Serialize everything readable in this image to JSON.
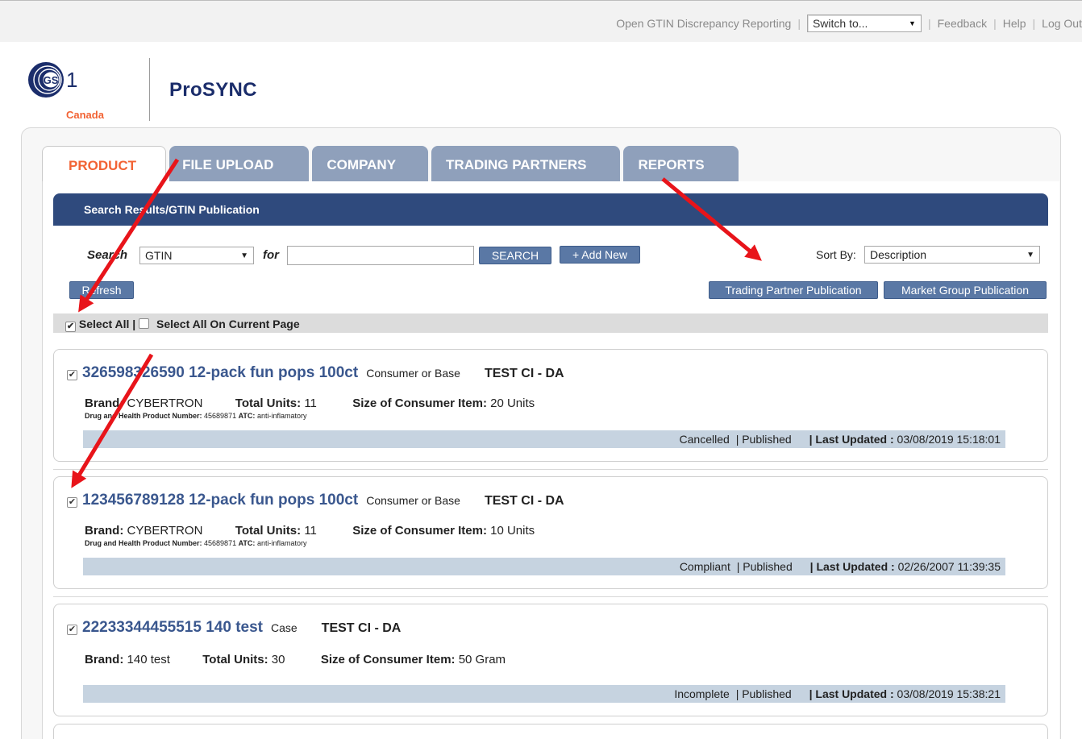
{
  "topbar": {
    "discrepancy_link": "Open GTIN Discrepancy Reporting",
    "switch_value": "Switch to...",
    "feedback": "Feedback",
    "help": "Help",
    "logout": "Log Out"
  },
  "logo": {
    "gs": "GS",
    "one": "1",
    "country": "Canada"
  },
  "app_title": "ProSYNC",
  "tabs": {
    "product": "PRODUCT",
    "file_upload": "FILE UPLOAD",
    "company": "COMPANY",
    "trading_partners": "TRADING PARTNERS",
    "reports": "REPORTS"
  },
  "results_header": "Search Results/GTIN Publication",
  "search": {
    "label": "Search",
    "field_value": "GTIN",
    "for_label": "for",
    "query": "",
    "search_button": "SEARCH",
    "add_new_button": "+ Add New",
    "sort_label": "Sort By:",
    "sort_value": "Description"
  },
  "actions": {
    "refresh": "Refresh",
    "trading_partner_publication": "Trading Partner Publication",
    "market_group_publication": "Market Group Publication"
  },
  "selectbar": {
    "select_all": "Select All |",
    "select_all_page": "Select All On Current Page"
  },
  "products": [
    {
      "gtin_desc": "326598326590 12-pack fun pops 100ct",
      "type": "Consumer or Base",
      "trading_company": "TEST CI - DA",
      "brand_label": "Brand:",
      "brand": "CYBERTRON",
      "units_label": "Total Units:",
      "units": "11",
      "size_label": "Size of Consumer Item:",
      "size": "20 Units",
      "dhpn_label": "Drug and Health Product Number:",
      "dhpn": "45689871",
      "atc_label": "ATC:",
      "atc": "anti-inflamatory",
      "status": "Cancelled",
      "pub": "| Published",
      "updated_label": "| Last Updated :",
      "updated": "03/08/2019 15:18:01"
    },
    {
      "gtin_desc": "123456789128 12-pack fun pops 100ct",
      "type": "Consumer or Base",
      "trading_company": "TEST CI - DA",
      "brand_label": "Brand:",
      "brand": "CYBERTRON",
      "units_label": "Total Units:",
      "units": "11",
      "size_label": "Size of Consumer Item:",
      "size": "10 Units",
      "dhpn_label": "Drug and Health Product Number:",
      "dhpn": "45689871",
      "atc_label": "ATC:",
      "atc": "anti-inflamatory",
      "status": "Compliant",
      "pub": "| Published",
      "updated_label": "| Last Updated :",
      "updated": "02/26/2007 11:39:35"
    },
    {
      "gtin_desc": "22233344455515 140 test",
      "type": "Case",
      "trading_company": "TEST CI - DA",
      "brand_label": "Brand:",
      "brand": "140 test",
      "units_label": "Total Units:",
      "units": "30",
      "size_label": "Size of Consumer Item:",
      "size": "50 Gram",
      "status": "Incomplete",
      "pub": "| Published",
      "updated_label": "| Last Updated :",
      "updated": "03/08/2019 15:38:21"
    }
  ],
  "colors": {
    "brand_navy": "#1b2d6b",
    "brand_orange": "#f26334",
    "header_blue": "#2f4a7d",
    "button_blue": "#5a78a5",
    "tab_inactive": "#8fa0bb",
    "status_bar": "#c6d3e0",
    "annotation_arrow": "#e8141a"
  }
}
